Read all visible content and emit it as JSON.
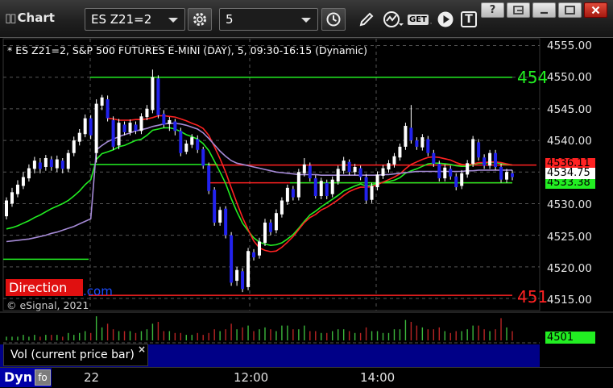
{
  "window": {
    "title": "Chart",
    "symbol_value": "ES Z21=2",
    "interval_value": "5",
    "buttons": [
      "?",
      "restore",
      "minimize",
      "maximize",
      "close"
    ]
  },
  "toolbar": {
    "icons": [
      "gear-icon",
      "clock-icon",
      "pencil-icon",
      "study-icon",
      "get-icon",
      "play-icon",
      "text-icon"
    ],
    "get_label": "GET",
    "text_label": "T"
  },
  "chart": {
    "title": "* ES Z21=2, S&P 500 FUTURES E-MINI (DAY), 5, 09:30-16:15 (Dynamic)",
    "direction_label": "Direction",
    "esignal_link": ".com",
    "copyright": "© eSignal, 2021",
    "level_top_label": "454",
    "level_bottom_label": "451",
    "colors": {
      "up": "#ffffff",
      "down": "#2222ee",
      "green": "#22ee22",
      "red": "#ff2222",
      "purple": "#a58ad6",
      "grid": "#555555"
    }
  },
  "chart_data": {
    "type": "candlestick",
    "y_ticks": [
      "4555.00",
      "4550.00",
      "4545.00",
      "4540.00",
      "4535.00",
      "4530.00",
      "4525.00",
      "4520.00",
      "4515.00"
    ],
    "ylim": [
      4513,
      4556.5
    ],
    "x_labels": [
      "22",
      "12:00",
      "14:00"
    ],
    "price_tags": {
      "red": "4536.11",
      "white": "4534.75",
      "green": "4533.38"
    },
    "horizontal_levels": {
      "green_top": 4550,
      "red_bottom": 4515.5,
      "red_mid_a": 4536.1,
      "red_mid_b": 4533.3,
      "green_mid": 4533.3,
      "green_left": 4536.2,
      "green_low": 4521.2
    },
    "candles": [
      [
        4528,
        4530.5,
        4527.5,
        4531
      ],
      [
        4530,
        4531.8,
        4529.5,
        4532.5
      ],
      [
        4531.5,
        4533,
        4531,
        4533.7
      ],
      [
        4532.8,
        4534.2,
        4532.3,
        4535
      ],
      [
        4534,
        4535.6,
        4533.5,
        4536.2
      ],
      [
        4535.5,
        4536.8,
        4534.8,
        4537.4
      ],
      [
        4536.5,
        4535.5,
        4534.8,
        4537.2
      ],
      [
        4535.8,
        4537.2,
        4535.2,
        4537.7
      ],
      [
        4537,
        4535.8,
        4535.2,
        4537.5
      ],
      [
        4535.6,
        4537,
        4535,
        4537.6
      ],
      [
        4536.8,
        4535.5,
        4534.8,
        4537.2
      ],
      [
        4535.5,
        4538,
        4535,
        4538.5
      ],
      [
        4538,
        4540,
        4537.5,
        4540.6
      ],
      [
        4539.8,
        4541.2,
        4539.2,
        4541.8
      ],
      [
        4541,
        4543.5,
        4540.5,
        4544.1
      ],
      [
        4543.5,
        4540.8,
        4540.2,
        4544
      ],
      [
        4538,
        4545.8,
        4536.5,
        4546.5
      ],
      [
        4545.5,
        4546.8,
        4544.8,
        4547.2
      ],
      [
        4546.5,
        4543.5,
        4543,
        4547.1
      ],
      [
        4543.2,
        4539,
        4538.5,
        4543.8
      ],
      [
        4539.2,
        4542.8,
        4538.6,
        4543.4
      ],
      [
        4542.5,
        4541.3,
        4540.8,
        4543
      ],
      [
        4541.3,
        4542.8,
        4540.8,
        4543.3
      ],
      [
        4542.5,
        4541.5,
        4541,
        4543
      ],
      [
        4541.5,
        4543.8,
        4541,
        4544.3
      ],
      [
        4543.7,
        4545,
        4543.2,
        4545.6
      ],
      [
        4544.8,
        4550,
        4544.3,
        4551.2
      ],
      [
        4549.8,
        4544,
        4543.5,
        4550.3
      ],
      [
        4544.2,
        4542.5,
        4542,
        4544.8
      ],
      [
        4542.6,
        4543.2,
        4541.5,
        4543.7
      ],
      [
        4543,
        4541.5,
        4540.8,
        4543.4
      ],
      [
        4541.5,
        4538,
        4537.5,
        4542
      ],
      [
        4538.2,
        4539.5,
        4537.8,
        4540
      ],
      [
        4539.3,
        4540.5,
        4538.8,
        4541
      ],
      [
        4540.2,
        4538.5,
        4538,
        4540.8
      ],
      [
        4538.6,
        4536,
        4535.5,
        4539
      ],
      [
        4536,
        4532,
        4531.5,
        4536.5
      ],
      [
        4532.2,
        4527,
        4526.5,
        4532.6
      ],
      [
        4527,
        4529,
        4526.5,
        4529.5
      ],
      [
        4529.2,
        4525,
        4524.5,
        4529.6
      ],
      [
        4525,
        4517.5,
        4517,
        4525.5
      ],
      [
        4517.8,
        4519.5,
        4517,
        4520
      ],
      [
        4519.3,
        4516.5,
        4516,
        4519.8
      ],
      [
        4516.8,
        4522.5,
        4516.3,
        4523
      ],
      [
        4522.3,
        4521.5,
        4521,
        4522.8
      ],
      [
        4521.8,
        4524,
        4521.3,
        4524.6
      ],
      [
        4523.8,
        4527,
        4523.3,
        4527.6
      ],
      [
        4527,
        4525.5,
        4525,
        4527.5
      ],
      [
        4525.8,
        4528.5,
        4525.3,
        4529.1
      ],
      [
        4528.3,
        4530.5,
        4527.8,
        4531
      ],
      [
        4530.3,
        4532.5,
        4529.8,
        4533
      ],
      [
        4532.3,
        4531,
        4530.5,
        4532.8
      ],
      [
        4531,
        4535,
        4530.5,
        4535.5
      ],
      [
        4534.8,
        4536.2,
        4534.3,
        4537.2
      ],
      [
        4536,
        4534,
        4533.5,
        4536.5
      ],
      [
        4534,
        4531.2,
        4530.8,
        4534.5
      ],
      [
        4531.2,
        4533.6,
        4530.7,
        4534.1
      ],
      [
        4533.3,
        4531.2,
        4530.7,
        4533.8
      ],
      [
        4531.5,
        4533.8,
        4531,
        4534.3
      ],
      [
        4533.5,
        4535.5,
        4533,
        4536
      ],
      [
        4535.2,
        4536.8,
        4534.7,
        4537.4
      ],
      [
        4536.6,
        4535,
        4534.5,
        4537
      ],
      [
        4535,
        4535.8,
        4534.5,
        4536.3
      ],
      [
        4535.6,
        4534.2,
        4533.7,
        4536
      ],
      [
        4534.2,
        4530.5,
        4530,
        4534.7
      ],
      [
        4530.6,
        4532.8,
        4530.1,
        4533.3
      ],
      [
        4532.6,
        4534.6,
        4532.1,
        4535.1
      ],
      [
        4534.4,
        4535.6,
        4533.9,
        4536.1
      ],
      [
        4535.4,
        4536.4,
        4534.9,
        4536.9
      ],
      [
        4536.2,
        4537.5,
        4535.7,
        4538
      ],
      [
        4537.3,
        4539,
        4536.8,
        4539.5
      ],
      [
        4539,
        4542.3,
        4538.5,
        4542.8
      ],
      [
        4542,
        4540,
        4539.5,
        4545.6
      ],
      [
        4540,
        4539,
        4538.5,
        4540.5
      ],
      [
        4538.9,
        4540.5,
        4538.4,
        4541
      ],
      [
        4540.2,
        4538,
        4537.5,
        4540.7
      ],
      [
        4538,
        4536.3,
        4535.8,
        4538.5
      ],
      [
        4536.3,
        4534,
        4533.5,
        4536.8
      ],
      [
        4534,
        4535.7,
        4533.5,
        4536.2
      ],
      [
        4535.5,
        4534.3,
        4533.8,
        4536
      ],
      [
        4534.3,
        4532.6,
        4532.1,
        4534.8
      ],
      [
        4532.8,
        4534.8,
        4532.3,
        4535.3
      ],
      [
        4534.6,
        4536.4,
        4534.1,
        4536.9
      ],
      [
        4536.3,
        4540.2,
        4535.8,
        4540.7
      ],
      [
        4539.7,
        4537.3,
        4536.8,
        4540.2
      ],
      [
        4537.3,
        4536,
        4535.5,
        4537.8
      ],
      [
        4536,
        4538,
        4535.5,
        4538.5
      ],
      [
        4538,
        4535.8,
        4535.3,
        4538.5
      ],
      [
        4535.8,
        4533.8,
        4533.3,
        4536.3
      ],
      [
        4533.8,
        4535,
        4533.3,
        4535.5
      ],
      [
        4534.8,
        4534.2,
        4533.7,
        4535.3
      ]
    ],
    "series": [
      {
        "name": "",
        "color": "green",
        "values": [
          4526,
          4526.2,
          4526.5,
          4526.9,
          4527.3,
          4527.8,
          4528.2,
          4528.7,
          4529.2,
          4529.6,
          4530,
          4530.5,
          4531.2,
          4532,
          4533,
          4533.8,
          4537,
          4537.9,
          4538.2,
          4538.5,
          4539,
          4539.2,
          4539.6,
          4540,
          4540.2,
          4540.8,
          4541.6,
          4541.8,
          4542,
          4542,
          4541.8,
          4541.4,
          4540.9,
          4540.6,
          4540.2,
          4539.5,
          4538.4,
          4536.7,
          4535,
          4533.2,
          4530.8,
          4528.7,
          4526.9,
          4525.7,
          4524.6,
          4523.9,
          4523.6,
          4523.4,
          4523.5,
          4523.8,
          4524.4,
          4525.1,
          4526.1,
          4527.2,
          4528.2,
          4528.8,
          4529.5,
          4530.1,
          4530.7,
          4531.3,
          4532,
          4532.4,
          4532.8,
          4533.1,
          4532.8,
          4533,
          4533.2,
          4533.4,
          4533.5,
          4533.7,
          4534.1,
          4534.8,
          4535.2,
          4535.5,
          4535.9,
          4536.3,
          4536.4,
          4536.4,
          4536.3,
          4536.2,
          4536,
          4535.9,
          4535.9,
          4536.2,
          4536.4,
          4536.4,
          4536.5,
          4536.5,
          4536.3,
          4536.2,
          4536.1
        ]
      },
      {
        "name": "",
        "color": "red",
        "values": [
          null,
          null,
          null,
          null,
          null,
          null,
          null,
          null,
          null,
          null,
          null,
          null,
          null,
          null,
          null,
          null,
          null,
          null,
          4543.5,
          4543.4,
          4543.2,
          4543.2,
          4543.2,
          4543.3,
          4543.3,
          4543.4,
          4543.6,
          4543.9,
          4543.9,
          4543.8,
          4543.7,
          4543.4,
          4543.1,
          4542.7,
          4542.4,
          4541.9,
          4540.8,
          4539,
          4537.1,
          4535,
          4532.5,
          4530.1,
          4527.8,
          4525.9,
          4524.1,
          4523,
          4522.6,
          4522.4,
          4522.5,
          4523.1,
          4523.9,
          4524.8,
          4525.9,
          4527,
          4527.8,
          4528.3,
          4529,
          4529.4,
          4530,
          4530.6,
          4531.3,
          4531.9,
          4532.3,
          4532.6,
          4532.6,
          4532.7,
          4533,
          4533.4,
          4533.8,
          4534.2,
          4534.7,
          4535.5,
          4536.2,
          4536.6,
          4537,
          4537.3,
          4537.4,
          4537.3,
          4537.1,
          4536.9,
          4536.5,
          4536.2,
          4536.1,
          4536.3,
          4536.5,
          4536.5,
          4536.6,
          4536.6,
          4536.5,
          4536.3,
          4536.1
        ]
      },
      {
        "name": "",
        "color": "purple",
        "values": [
          4524,
          4524.1,
          4524.2,
          4524.3,
          4524.4,
          4524.6,
          4524.8,
          4525,
          4525.3,
          4525.5,
          4525.8,
          4526.1,
          4526.4,
          4526.8,
          4527.2,
          4527.6,
          4538.5,
          4539.2,
          4539.8,
          4540.2,
          4540.6,
          4540.9,
          4541.2,
          4541.5,
          4541.7,
          4541.9,
          4542.2,
          4542.4,
          4542.6,
          4542.7,
          4542.7,
          4542.6,
          4542.4,
          4542.1,
          4541.8,
          4541.2,
          4540.3,
          4539.3,
          4538.3,
          4537.5,
          4536.8,
          4536.4,
          4536.2,
          4536,
          4535.8,
          4535.6,
          4535.4,
          4535.2,
          4535,
          4534.9,
          4534.8,
          4534.7,
          4534.6,
          4534.6,
          4534.6,
          4534.6,
          4534.5,
          4534.5,
          4534.5,
          4534.5,
          4534.5,
          4534.5,
          4534.5,
          4534.5,
          4534.5,
          4534.5,
          4534.5,
          4534.6,
          4534.6,
          4534.7,
          4534.8,
          4534.9,
          4535,
          4535.1,
          4535.1,
          4535.1,
          4535.1,
          4535.1,
          4535.1,
          4535.1,
          4535.1,
          4535.1,
          4535.2,
          4535.2,
          4535.3,
          4535.3,
          4535.3,
          4535.3,
          4535.3,
          4535.3,
          4535.3
        ]
      }
    ]
  },
  "volume": {
    "label": "Vol (current price bar)",
    "close_glyph": "×",
    "value_tag": "4501",
    "bars": [
      2,
      2,
      2,
      3,
      2,
      3,
      2,
      3,
      3,
      3,
      2,
      4,
      3,
      4,
      5,
      4,
      13,
      7,
      9,
      6,
      5,
      5,
      5,
      4,
      5,
      6,
      9,
      10,
      5,
      5,
      4,
      4,
      3,
      3,
      4,
      3,
      4,
      6,
      5,
      6,
      9,
      6,
      7,
      8,
      5,
      6,
      7,
      6,
      5,
      8,
      8,
      6,
      6,
      8,
      5,
      5,
      4,
      4,
      5,
      6,
      6,
      5,
      4,
      4,
      7,
      5,
      5,
      4,
      4,
      6,
      6,
      11,
      10,
      8,
      7,
      6,
      6,
      7,
      5,
      4,
      5,
      5,
      6,
      8,
      8,
      6,
      5,
      6,
      12,
      7,
      5
    ]
  },
  "bottom": {
    "dyn_label": "Dyn",
    "dyn_icon": "fo",
    "time_labels": [
      "22",
      "12:00",
      "14:00"
    ]
  }
}
